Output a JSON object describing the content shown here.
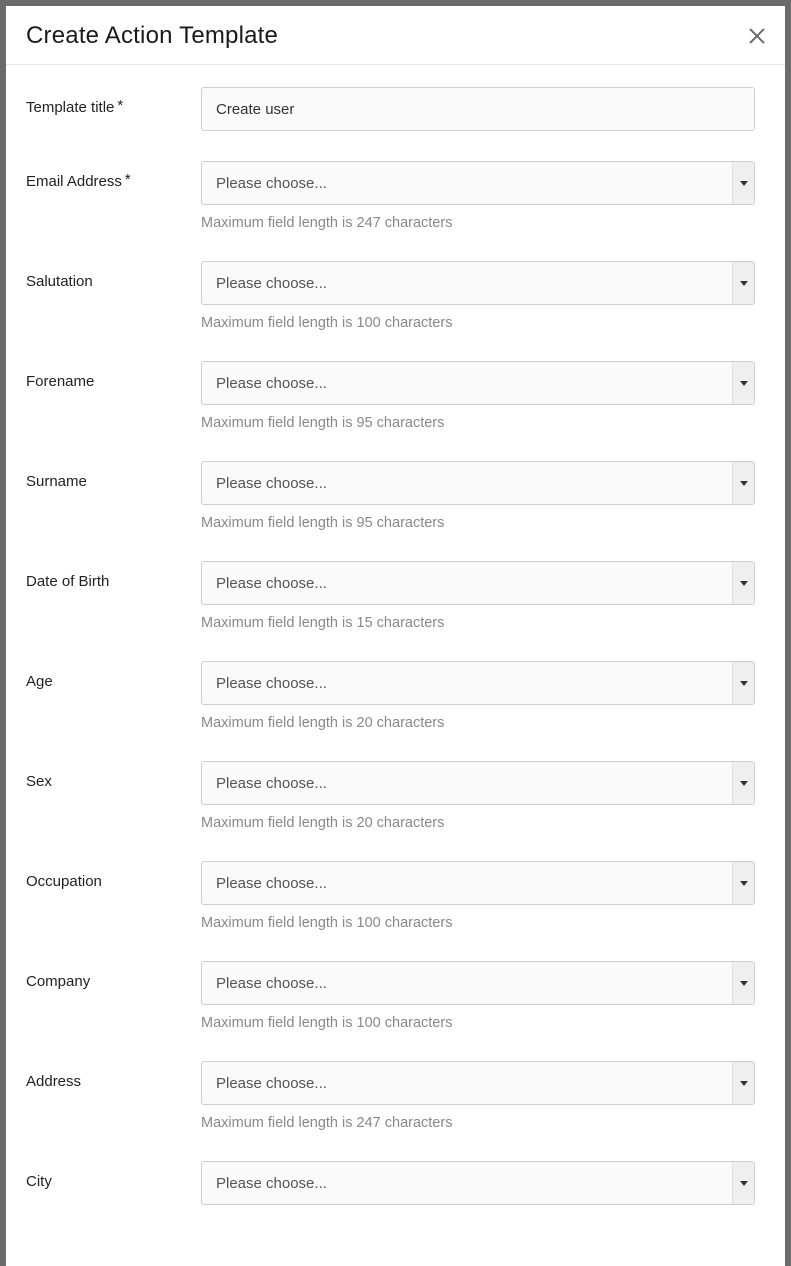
{
  "modal": {
    "title": "Create Action Template"
  },
  "form": {
    "title": {
      "label": "Template title",
      "required": "*",
      "value": "Create user"
    },
    "email": {
      "label": "Email Address",
      "required": "*",
      "placeholder": "Please choose...",
      "hint": "Maximum field length is 247 characters"
    },
    "salutation": {
      "label": "Salutation",
      "placeholder": "Please choose...",
      "hint": "Maximum field length is 100 characters"
    },
    "forename": {
      "label": "Forename",
      "placeholder": "Please choose...",
      "hint": "Maximum field length is 95 characters"
    },
    "surname": {
      "label": "Surname",
      "placeholder": "Please choose...",
      "hint": "Maximum field length is 95 characters"
    },
    "dob": {
      "label": "Date of Birth",
      "placeholder": "Please choose...",
      "hint": "Maximum field length is 15 characters"
    },
    "age": {
      "label": "Age",
      "placeholder": "Please choose...",
      "hint": "Maximum field length is 20 characters"
    },
    "sex": {
      "label": "Sex",
      "placeholder": "Please choose...",
      "hint": "Maximum field length is 20 characters"
    },
    "occupation": {
      "label": "Occupation",
      "placeholder": "Please choose...",
      "hint": "Maximum field length is 100 characters"
    },
    "company": {
      "label": "Company",
      "placeholder": "Please choose...",
      "hint": "Maximum field length is 100 characters"
    },
    "address": {
      "label": "Address",
      "placeholder": "Please choose...",
      "hint": "Maximum field length is 247 characters"
    },
    "city": {
      "label": "City",
      "placeholder": "Please choose..."
    }
  }
}
